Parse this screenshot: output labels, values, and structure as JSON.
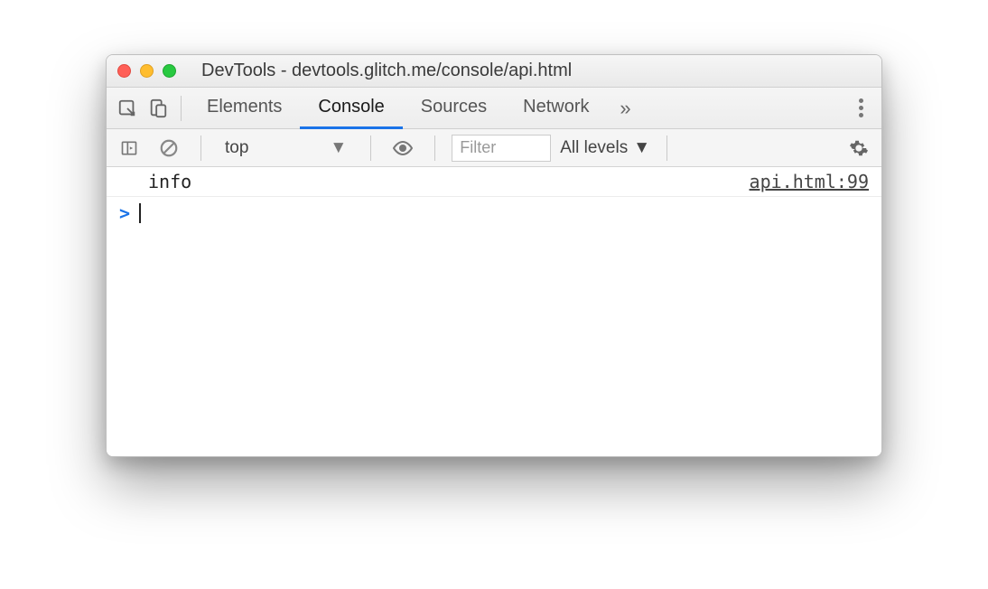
{
  "window": {
    "title": "DevTools - devtools.glitch.me/console/api.html"
  },
  "tabs": {
    "items": [
      "Elements",
      "Console",
      "Sources",
      "Network"
    ],
    "active": "Console",
    "overflow_glyph": "»"
  },
  "filter": {
    "context": "top",
    "placeholder": "Filter",
    "levels_label": "All levels"
  },
  "console": {
    "rows": [
      {
        "message": "info",
        "source": "api.html:99"
      }
    ],
    "prompt_glyph": ">"
  }
}
